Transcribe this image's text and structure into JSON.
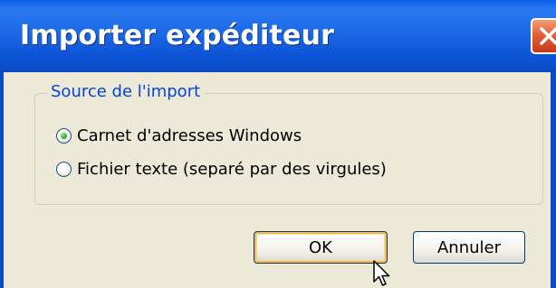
{
  "window": {
    "title": "Importer expéditeur"
  },
  "group": {
    "label": "Source de l'import",
    "options": [
      {
        "label": "Carnet d'adresses Windows",
        "checked": true
      },
      {
        "label": "Fichier texte (separé par des virgules)",
        "checked": false
      }
    ]
  },
  "buttons": {
    "ok_label": "OK",
    "cancel_label": "Annuler"
  },
  "icons": {
    "close": "close-icon",
    "cursor": "mouse-pointer-icon"
  },
  "colors": {
    "titlebar": "#1f6ce9",
    "group_label": "#0046d5",
    "dialog_bg": "#ece9d8",
    "close_button": "#e0603a",
    "default_button_highlight": "#f8b94e"
  }
}
